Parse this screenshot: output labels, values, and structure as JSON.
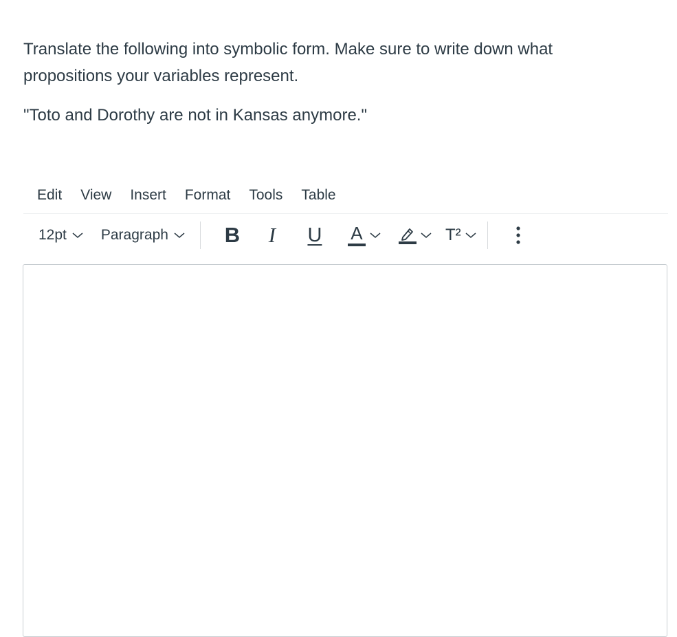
{
  "question": {
    "instruction": "Translate the following into symbolic form. Make sure to write down what propositions your variables represent.",
    "quote": "\"Toto and Dorothy are not in Kansas anymore.\""
  },
  "menubar": {
    "items": [
      {
        "label": "Edit"
      },
      {
        "label": "View"
      },
      {
        "label": "Insert"
      },
      {
        "label": "Format"
      },
      {
        "label": "Tools"
      },
      {
        "label": "Table"
      }
    ]
  },
  "toolbar": {
    "font_size": "12pt",
    "block_format": "Paragraph",
    "bold": "B",
    "italic": "I",
    "underline": "U",
    "text_color": "A",
    "superscript": "T²",
    "icons": {
      "font_size_chevron": "chevron-down-icon",
      "block_chevron": "chevron-down-icon",
      "text_color_chevron": "chevron-down-icon",
      "highlight": "highlighter-icon",
      "highlight_chevron": "chevron-down-icon",
      "superscript_chevron": "chevron-down-icon",
      "more": "more-vertical-icon"
    }
  },
  "colors": {
    "text": "#2d3b45",
    "border": "#c7cdd1",
    "separator": "#d7dadd"
  }
}
